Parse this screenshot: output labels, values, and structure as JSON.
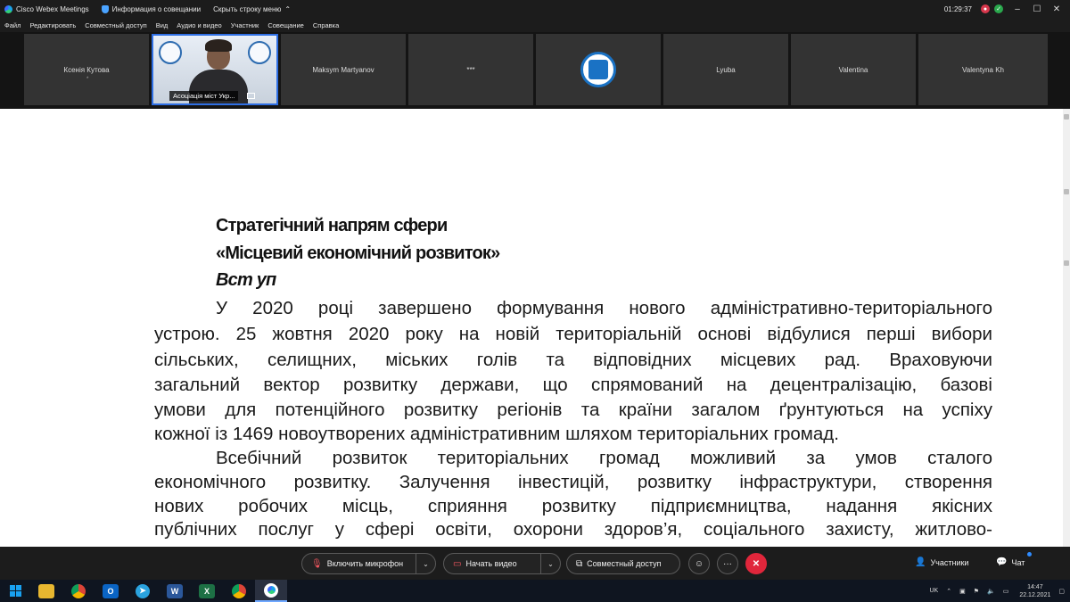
{
  "titlebar": {
    "app_name": "Cisco Webex Meetings",
    "meeting_info": "Информация о совещании",
    "hide_menu": "Скрыть строку меню",
    "time": "01:29:37"
  },
  "menu": [
    "Файл",
    "Редактировать",
    "Совместный доступ",
    "Вид",
    "Аудио и видео",
    "Участник",
    "Совещание",
    "Справка"
  ],
  "participants": {
    "p1": "Ксенія Кутова",
    "p1_sub": "*",
    "active_caption": "Асоціація міст Укр...",
    "p3": "Maksym Martyanov",
    "p4": "***",
    "p6": "Lyuba",
    "p7": "Valentina",
    "p8": "Valentyna Kh"
  },
  "document": {
    "h1": "Стратегічний напрям сфери",
    "h2": "«Місцевий економічний розвиток»",
    "h3": "Вст уп",
    "lines": [
      "У 2020 році завершено формування нового адміністративно-територіального",
      "устрою. 25 жовтня 2020 року на новій територіальній основі відбулися перші вибори",
      "сільських, селищних, міських голів та відповідних місцевих рад.  Враховуючи",
      "загальний вектор розвитку держави, що спрямований на децентралізацію, базові",
      "умови для потенційного розвитку регіонів та країни загалом ґрунтуються на успіху",
      "кожної із 1469 новоутворених адміністративним шляхом територіальних громад.",
      "Всебічний розвиток територіальних громад  можливий  за умов сталого",
      "економічного розвитку. Залучення інвестицій, розвитку інфраструктури, створення",
      "нових робочих місць, сприяння розвитку підприємництва,    надання якісних",
      "публічних послуг у сфері освіти, охорони здоров’я, соціального захисту, житлово-"
    ]
  },
  "controls": {
    "mic": "Включить микрофон",
    "video": "Начать видео",
    "share": "Совместный доступ",
    "more": "···",
    "end": "✕",
    "participants": "Участники",
    "chat": "Чат"
  },
  "taskbar": {
    "lang": "UK",
    "time": "14:47",
    "date": "22.12.2021"
  }
}
